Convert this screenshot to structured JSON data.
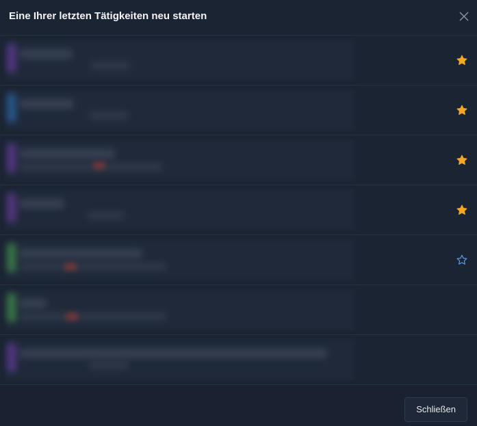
{
  "dialog": {
    "title": "Eine Ihrer letzten Tätigkeiten neu starten",
    "close_icon": "close-icon"
  },
  "rows": [
    {
      "favorite": true,
      "thumb_color": "#7a3fb5",
      "accent_color": ""
    },
    {
      "favorite": true,
      "thumb_color": "#2b79c9",
      "accent_color": ""
    },
    {
      "favorite": true,
      "thumb_color": "#7a3fb5",
      "accent_color": "#c0392b"
    },
    {
      "favorite": true,
      "thumb_color": "#7a3fb5",
      "accent_color": ""
    },
    {
      "favorite": false,
      "thumb_color": "#4caf50",
      "accent_color": "#c0392b"
    },
    {
      "favorite": false,
      "thumb_color": "#4caf50",
      "accent_color": "#c0392b"
    },
    {
      "favorite": false,
      "thumb_color": "#7a3fb5",
      "accent_color": ""
    }
  ],
  "colors": {
    "star_filled": "#f5a623",
    "star_outline": "#5b9be8"
  },
  "footer": {
    "close_label": "Schließen"
  }
}
